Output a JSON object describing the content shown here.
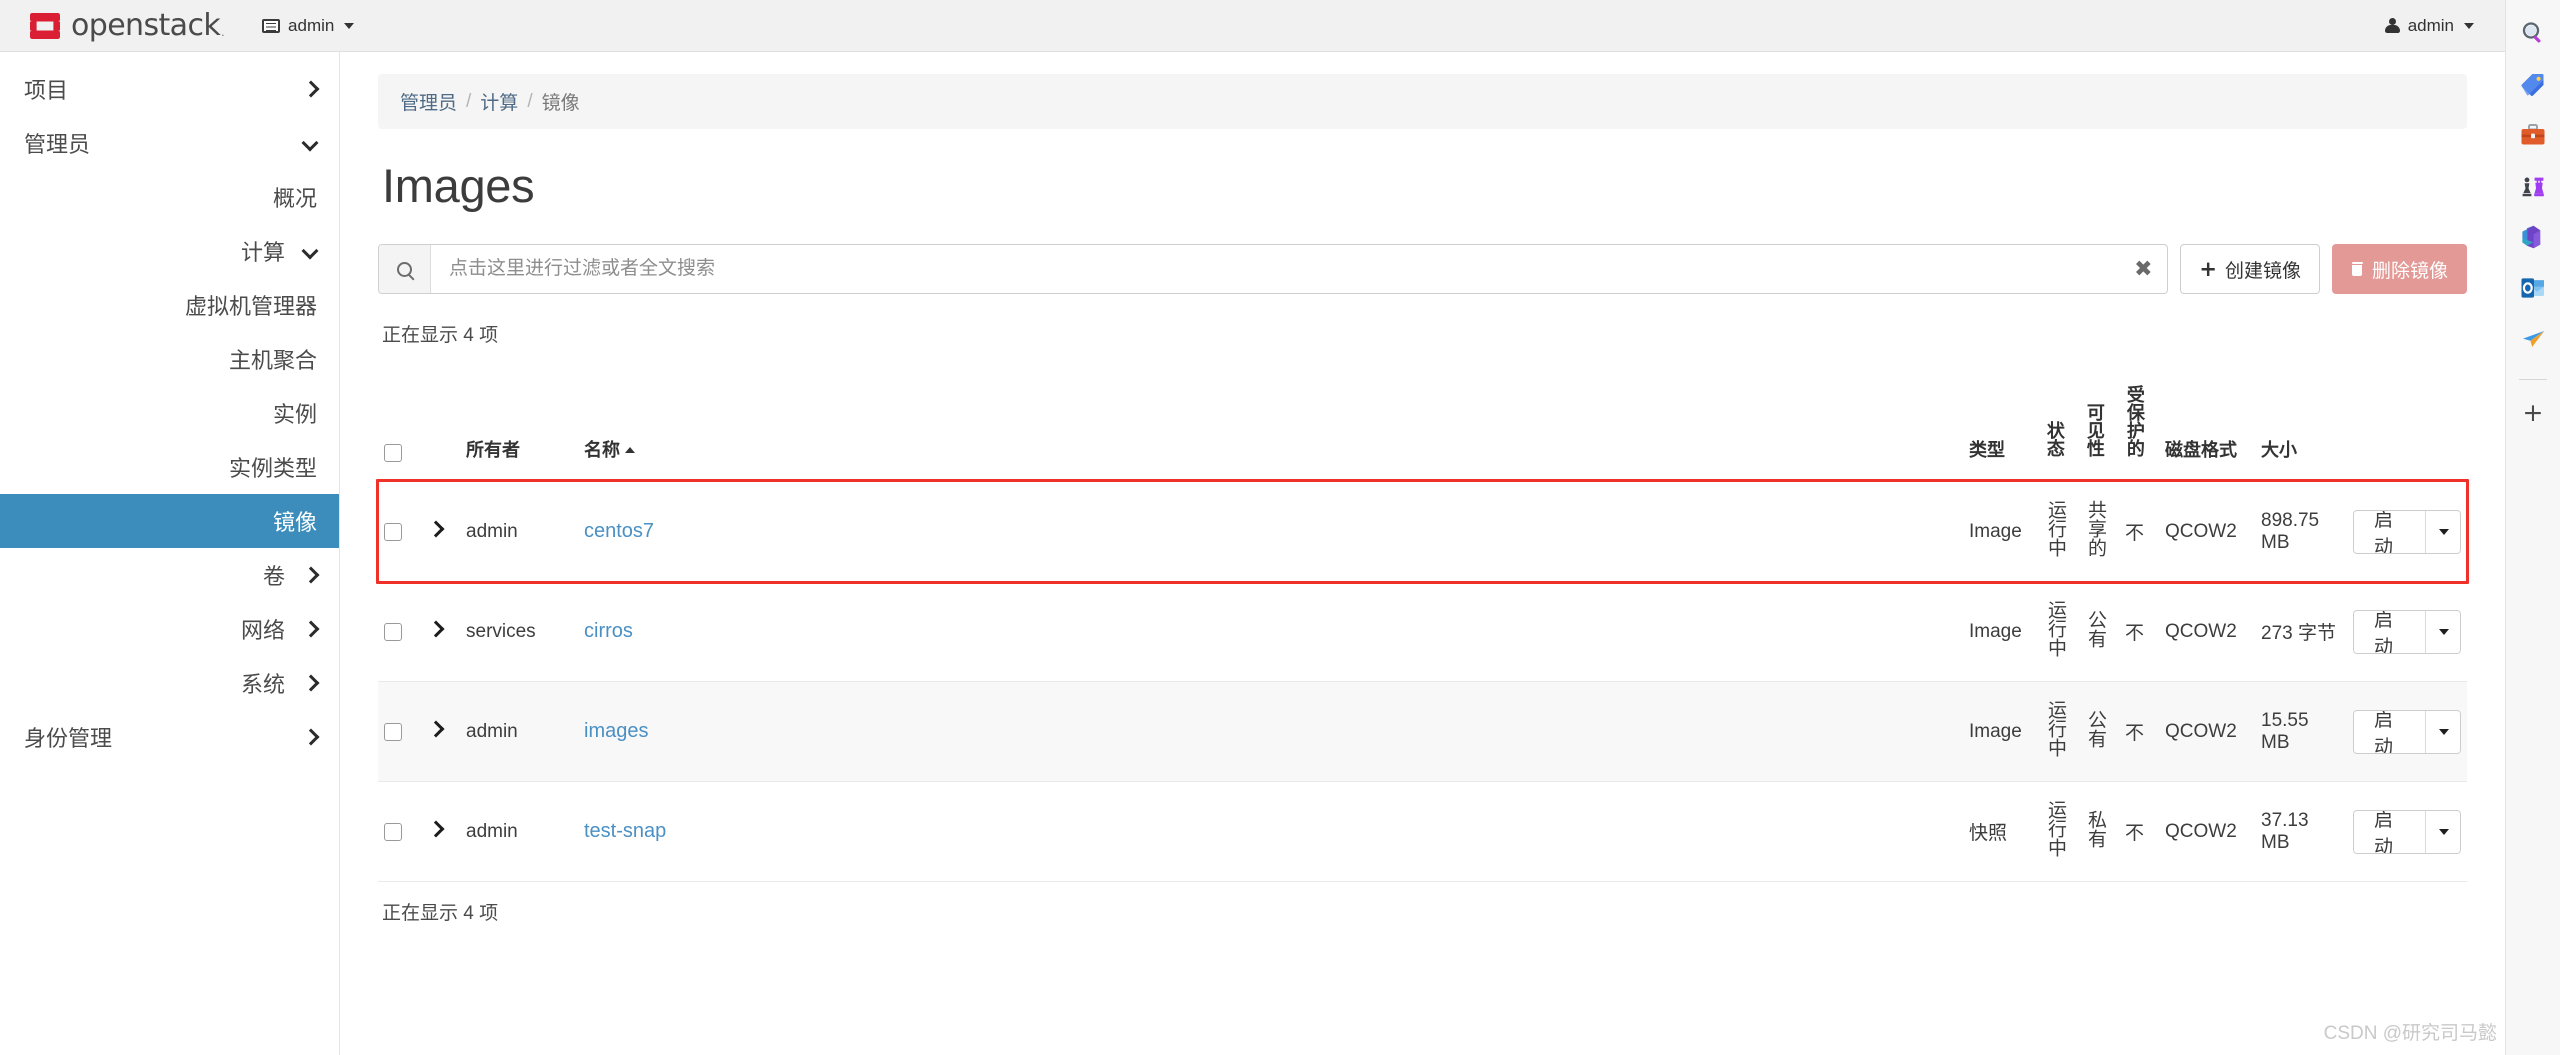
{
  "navbar": {
    "brand_text": "openstack",
    "brand_reg": ".",
    "project_switcher": "admin",
    "user_menu": "admin"
  },
  "sidebar": {
    "items": [
      {
        "label": "项目",
        "level": 0,
        "chevron": "right",
        "active": false
      },
      {
        "label": "管理员",
        "level": 0,
        "chevron": "down",
        "active": false
      },
      {
        "label": "概况",
        "level": 1,
        "chevron": "none",
        "active": false
      },
      {
        "label": "计算",
        "level": 1,
        "chevron": "down",
        "active": false
      },
      {
        "label": "虚拟机管理器",
        "level": 2,
        "chevron": "none",
        "active": false
      },
      {
        "label": "主机聚合",
        "level": 2,
        "chevron": "none",
        "active": false
      },
      {
        "label": "实例",
        "level": 2,
        "chevron": "none",
        "active": false
      },
      {
        "label": "实例类型",
        "level": 2,
        "chevron": "none",
        "active": false
      },
      {
        "label": "镜像",
        "level": 2,
        "chevron": "none",
        "active": true
      },
      {
        "label": "卷",
        "level": 1,
        "chevron": "right",
        "active": false
      },
      {
        "label": "网络",
        "level": 1,
        "chevron": "right",
        "active": false
      },
      {
        "label": "系统",
        "level": 1,
        "chevron": "right",
        "active": false
      },
      {
        "label": "身份管理",
        "level": 0,
        "chevron": "right",
        "active": false
      }
    ]
  },
  "breadcrumb": {
    "items": [
      "管理员",
      "计算",
      "镜像"
    ],
    "separator": "/"
  },
  "page": {
    "title": "Images"
  },
  "toolbar": {
    "search_placeholder": "点击这里进行过滤或者全文搜索",
    "search_value": "",
    "clear_label": "✖",
    "create_label": "创建镜像",
    "delete_label": "删除镜像",
    "delete_color": "#e39995"
  },
  "table": {
    "count_top": "正在显示 4 项",
    "count_bottom": "正在显示 4 项",
    "headers": {
      "owner": "所有者",
      "name": "名称",
      "type": "类型",
      "status": "状态",
      "visibility": "可见性",
      "protected": "受保护的",
      "disk_format": "磁盘格式",
      "size": "大小"
    },
    "sort_column": "名称",
    "sort_direction": "asc",
    "rows": [
      {
        "owner": "admin",
        "name": "centos7",
        "type": "Image",
        "status": "运行中",
        "visibility": "共享的",
        "protected": "不",
        "disk_format": "QCOW2",
        "size": "898.75 MB",
        "action_label": "启动",
        "highlighted": true
      },
      {
        "owner": "services",
        "name": "cirros",
        "type": "Image",
        "status": "运行中",
        "visibility": "公有",
        "protected": "不",
        "disk_format": "QCOW2",
        "size": "273 字节",
        "action_label": "启动",
        "highlighted": false
      },
      {
        "owner": "admin",
        "name": "images",
        "type": "Image",
        "status": "运行中",
        "visibility": "公有",
        "protected": "不",
        "disk_format": "QCOW2",
        "size": "15.55 MB",
        "action_label": "启动",
        "highlighted": false
      },
      {
        "owner": "admin",
        "name": "test-snap",
        "type": "快照",
        "status": "运行中",
        "visibility": "私有",
        "protected": "不",
        "disk_format": "QCOW2",
        "size": "37.13 MB",
        "action_label": "启动",
        "highlighted": false
      }
    ]
  },
  "highlight_color": "#f0312a",
  "watermark": "CSDN @研究司马懿",
  "browser_rail": {
    "items": [
      {
        "icon": "search-icon"
      },
      {
        "icon": "tag-icon"
      },
      {
        "icon": "briefcase-icon"
      },
      {
        "icon": "chess-icon"
      },
      {
        "icon": "microsoft365-icon"
      },
      {
        "icon": "outlook-icon"
      },
      {
        "icon": "send-plane-icon"
      }
    ],
    "add_label": "+"
  }
}
